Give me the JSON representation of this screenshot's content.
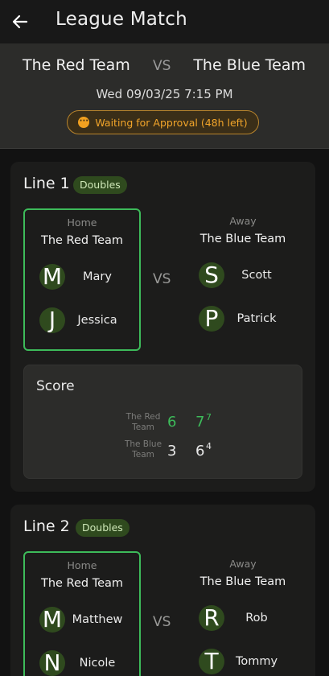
{
  "appbar": {
    "title": "League Match",
    "back_icon": "arrow-left-icon"
  },
  "match": {
    "home_team": "The Red Team",
    "vs": "VS",
    "away_team": "The Blue Team",
    "datetime": "Wed 09/03/25 7:15 PM",
    "status": "Waiting for Approval (48h left)",
    "status_color": "#f0a020"
  },
  "lines": [
    {
      "title": "Line 1",
      "badge": "Doubles",
      "home_label": "Home",
      "home_team": "The Red Team",
      "away_label": "Away",
      "away_team": "The Blue Team",
      "vs": "VS",
      "home_players": [
        {
          "initial": "M",
          "name": "Mary"
        },
        {
          "initial": "J",
          "name": "Jessica"
        }
      ],
      "away_players": [
        {
          "initial": "S",
          "name": "Scott"
        },
        {
          "initial": "P",
          "name": "Patrick"
        }
      ],
      "score": {
        "title": "Score",
        "home_team": "The Red Team",
        "away_team": "The Blue Team",
        "home_sets": [
          "6",
          "7"
        ],
        "home_tiebreak": "7",
        "away_sets": [
          "3",
          "6"
        ],
        "away_tiebreak": "4"
      }
    },
    {
      "title": "Line 2",
      "badge": "Doubles",
      "home_label": "Home",
      "home_team": "The Red Team",
      "away_label": "Away",
      "away_team": "The Blue Team",
      "vs": "VS",
      "home_players": [
        {
          "initial": "M",
          "name": "Matthew"
        },
        {
          "initial": "N",
          "name": "Nicole"
        }
      ],
      "away_players": [
        {
          "initial": "R",
          "name": "Rob"
        },
        {
          "initial": "T",
          "name": "Tommy"
        }
      ]
    }
  ],
  "colors": {
    "accent_green": "#3dbb5a",
    "badge_bg": "#2f4a1e",
    "warning": "#f2a52a"
  }
}
